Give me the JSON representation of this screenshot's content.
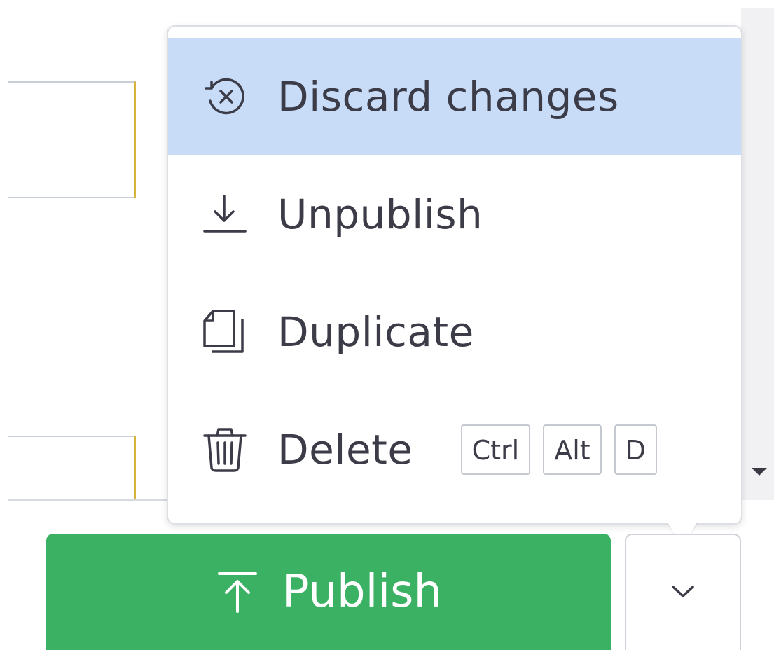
{
  "menu": {
    "items": [
      {
        "label": "Discard changes",
        "icon": "discard-icon",
        "active": true
      },
      {
        "label": "Unpublish",
        "icon": "unpublish-icon",
        "active": false
      },
      {
        "label": "Duplicate",
        "icon": "duplicate-icon",
        "active": false
      },
      {
        "label": "Delete",
        "icon": "trash-icon",
        "active": false,
        "shortcut": [
          "Ctrl",
          "Alt",
          "D"
        ]
      }
    ]
  },
  "footer": {
    "publish_label": "Publish",
    "publish_icon": "publish-arrow-icon",
    "toggle_icon": "chevron-down-icon"
  },
  "colors": {
    "active_item_bg": "#c8dcf8",
    "publish_green": "#3bb164",
    "text": "#3c3c48"
  }
}
